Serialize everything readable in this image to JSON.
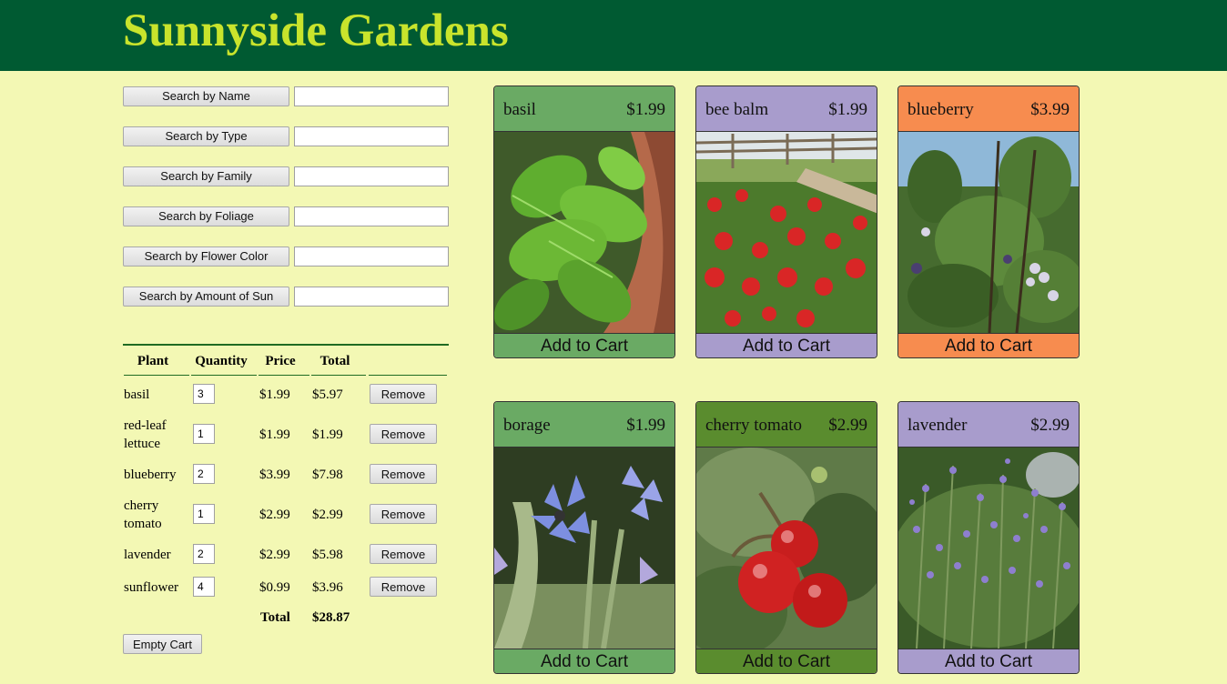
{
  "site": {
    "title": "Sunnyside Gardens"
  },
  "search": [
    {
      "label": "Search by Name",
      "value": ""
    },
    {
      "label": "Search by Type",
      "value": ""
    },
    {
      "label": "Search by Family",
      "value": ""
    },
    {
      "label": "Search by Foliage",
      "value": ""
    },
    {
      "label": "Search by Flower Color",
      "value": ""
    },
    {
      "label": "Search by Amount of Sun",
      "value": ""
    }
  ],
  "cart": {
    "headers": {
      "plant": "Plant",
      "quantity": "Quantity",
      "price": "Price",
      "total": "Total"
    },
    "items": [
      {
        "plant": "basil",
        "quantity": "3",
        "price": "$1.99",
        "total": "$5.97",
        "remove": "Remove"
      },
      {
        "plant": "red-leaf lettuce",
        "quantity": "1",
        "price": "$1.99",
        "total": "$1.99",
        "remove": "Remove"
      },
      {
        "plant": "blueberry",
        "quantity": "2",
        "price": "$3.99",
        "total": "$7.98",
        "remove": "Remove"
      },
      {
        "plant": "cherry tomato",
        "quantity": "1",
        "price": "$2.99",
        "total": "$2.99",
        "remove": "Remove"
      },
      {
        "plant": "lavender",
        "quantity": "2",
        "price": "$2.99",
        "total": "$5.98",
        "remove": "Remove"
      },
      {
        "plant": "sunflower",
        "quantity": "4",
        "price": "$0.99",
        "total": "$3.96",
        "remove": "Remove"
      }
    ],
    "grand_total_label": "Total",
    "grand_total": "$28.87",
    "empty_label": "Empty Cart"
  },
  "products": [
    {
      "name": "basil",
      "price": "$1.99",
      "color": "#6aaa64",
      "add_label": "Add to Cart",
      "image": "basil-photo"
    },
    {
      "name": "bee balm",
      "price": "$1.99",
      "color": "#a89ccc",
      "add_label": "Add to Cart",
      "image": "bee-balm-photo"
    },
    {
      "name": "blueberry",
      "price": "$3.99",
      "color": "#f78c4f",
      "add_label": "Add to Cart",
      "image": "blueberry-photo"
    },
    {
      "name": "borage",
      "price": "$1.99",
      "color": "#6aaa64",
      "add_label": "Add to Cart",
      "image": "borage-photo"
    },
    {
      "name": "cherry tomato",
      "price": "$2.99",
      "color": "#5a8c2e",
      "add_label": "Add to Cart",
      "image": "cherry-tomato-photo"
    },
    {
      "name": "lavender",
      "price": "$2.99",
      "color": "#a89ccc",
      "add_label": "Add to Cart",
      "image": "lavender-photo"
    }
  ],
  "colors": {
    "header": "#005a32",
    "title": "#c9e42c",
    "background": "#f3f8b4"
  }
}
